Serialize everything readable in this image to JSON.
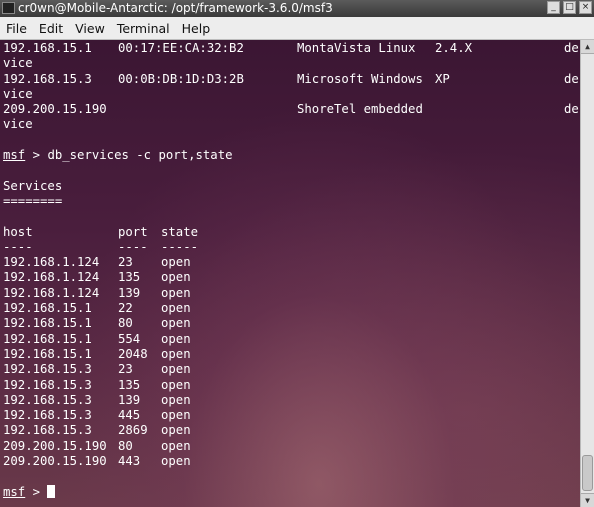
{
  "window": {
    "title": "cr0wn@Mobile-Antarctic: /opt/framework-3.6.0/msf3"
  },
  "menu": [
    "File",
    "Edit",
    "View",
    "Terminal",
    "Help"
  ],
  "hosts": [
    {
      "ip": "192.168.15.1",
      "mac": "00:17:EE:CA:32:B2",
      "os": "MontaVista Linux",
      "version": "2.4.X",
      "purpose_start": "de",
      "purpose_end": "vice"
    },
    {
      "ip": "192.168.15.3",
      "mac": "00:0B:DB:1D:D3:2B",
      "os": "Microsoft Windows",
      "version": "XP",
      "purpose_start": "de",
      "purpose_end": "vice"
    },
    {
      "ip": "209.200.15.190",
      "mac": "",
      "os": "ShoreTel embedded",
      "version": "",
      "purpose_start": "de",
      "purpose_end": "vice"
    }
  ],
  "command": {
    "prompt": "msf",
    "separator": " > ",
    "text": "db_services -c port,state"
  },
  "services": {
    "title": "Services",
    "underline": "========",
    "headers": {
      "host": "host",
      "port": "port",
      "state": "state"
    },
    "header_rule": {
      "host": "----",
      "port": "----",
      "state": "-----"
    },
    "rows": [
      {
        "host": "192.168.1.124",
        "port": "23",
        "state": "open"
      },
      {
        "host": "192.168.1.124",
        "port": "135",
        "state": "open"
      },
      {
        "host": "192.168.1.124",
        "port": "139",
        "state": "open"
      },
      {
        "host": "192.168.15.1",
        "port": "22",
        "state": "open"
      },
      {
        "host": "192.168.15.1",
        "port": "80",
        "state": "open"
      },
      {
        "host": "192.168.15.1",
        "port": "554",
        "state": "open"
      },
      {
        "host": "192.168.15.1",
        "port": "2048",
        "state": "open"
      },
      {
        "host": "192.168.15.3",
        "port": "23",
        "state": "open"
      },
      {
        "host": "192.168.15.3",
        "port": "135",
        "state": "open"
      },
      {
        "host": "192.168.15.3",
        "port": "139",
        "state": "open"
      },
      {
        "host": "192.168.15.3",
        "port": "445",
        "state": "open"
      },
      {
        "host": "192.168.15.3",
        "port": "2869",
        "state": "open"
      },
      {
        "host": "209.200.15.190",
        "port": "80",
        "state": "open"
      },
      {
        "host": "209.200.15.190",
        "port": "443",
        "state": "open"
      }
    ]
  },
  "final_prompt": {
    "prompt": "msf",
    "separator": " > "
  }
}
